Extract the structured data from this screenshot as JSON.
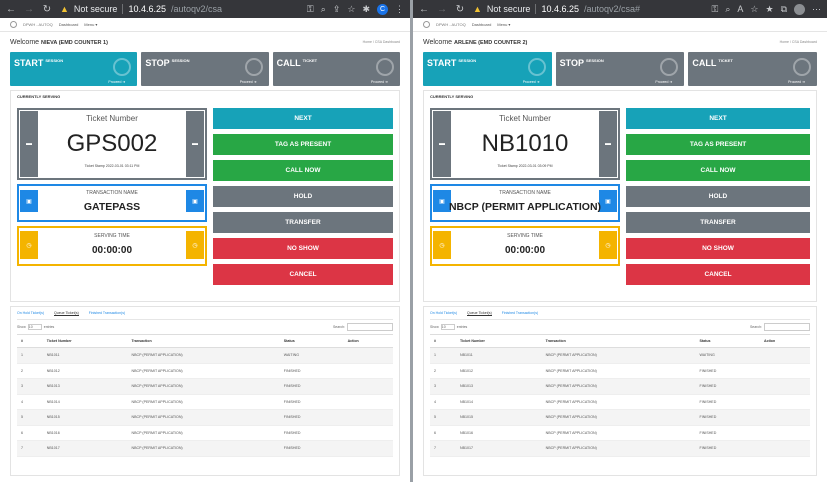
{
  "browser": {
    "security": "Not secure",
    "host": "10.4.6.25",
    "left_path": "/autoqv2/csa",
    "right_path": "/autoqv2/csa#"
  },
  "app": {
    "brand": "DPWH - AUTOQ",
    "menu_dashboard": "Dashboard",
    "menu_more": "Menu ▾",
    "crumbs": "Home / CSA Dashboard"
  },
  "cards": {
    "start": "START",
    "start_sub": "SESSION",
    "stop": "STOP",
    "stop_sub": "SESSION",
    "call": "CALL",
    "call_sub": "TICKET",
    "proceed": "Proceed ➔"
  },
  "labels": {
    "currently_serving": "CURRENTLY SERVING",
    "ticket_number": "Ticket Number",
    "transaction_name": "TRANSACTION NAME",
    "serving_time": "SERVING TIME",
    "ticket_stamp_prefix": "Ticket Stamp"
  },
  "buttons": {
    "next": "NEXT",
    "tag": "TAG AS PRESENT",
    "callnow": "CALL NOW",
    "hold": "HOLD",
    "transfer": "TRANSFER",
    "noshow": "NO SHOW",
    "cancel": "CANCEL"
  },
  "tabs": {
    "onhold": "On Hold Ticket(s)",
    "queue": "Queue Ticket(s)",
    "finished": "Finished Transaction(s)"
  },
  "table": {
    "show": "Show",
    "len": "10",
    "entries": "entries",
    "search": "Search:",
    "headers": [
      "#",
      "Ticket Number",
      "Transaction",
      "Status",
      "Action"
    ]
  },
  "left": {
    "welcome": "Welcome",
    "name": "NIEVA (EMD COUNTER 1)",
    "ticket": "GPS002",
    "stamp": "Ticket Stamp 2022-03-01 03:11 PM",
    "transaction": "GATEPASS",
    "serving_time": "00:00:00",
    "rows": [
      [
        "1",
        "NB1011",
        "NBCP (PERMIT APPLICATION)",
        "WAITING"
      ],
      [
        "2",
        "NB1012",
        "NBCP (PERMIT APPLICATION)",
        "FINISHED"
      ],
      [
        "3",
        "NB1013",
        "NBCP (PERMIT APPLICATION)",
        "FINISHED"
      ],
      [
        "4",
        "NB1014",
        "NBCP (PERMIT APPLICATION)",
        "FINISHED"
      ],
      [
        "5",
        "NB1015",
        "NBCP (PERMIT APPLICATION)",
        "FINISHED"
      ],
      [
        "6",
        "NB1016",
        "NBCP (PERMIT APPLICATION)",
        "FINISHED"
      ],
      [
        "7",
        "NB1017",
        "NBCP (PERMIT APPLICATION)",
        "FINISHED"
      ]
    ]
  },
  "right": {
    "welcome": "Welcome",
    "name": "ARLENE (EMD COUNTER 2)",
    "ticket": "NB1010",
    "stamp": "Ticket Stamp 2022-03-01 03:09 PM",
    "transaction": "NBCP (PERMIT APPLICATION)",
    "serving_time": "00:00:00",
    "rows": [
      [
        "1",
        "NB1011",
        "NBCP (PERMIT APPLICATION)",
        "WAITING"
      ],
      [
        "2",
        "NB1012",
        "NBCP (PERMIT APPLICATION)",
        "FINISHED"
      ],
      [
        "3",
        "NB1013",
        "NBCP (PERMIT APPLICATION)",
        "FINISHED"
      ],
      [
        "4",
        "NB1014",
        "NBCP (PERMIT APPLICATION)",
        "FINISHED"
      ],
      [
        "5",
        "NB1015",
        "NBCP (PERMIT APPLICATION)",
        "FINISHED"
      ],
      [
        "6",
        "NB1016",
        "NBCP (PERMIT APPLICATION)",
        "FINISHED"
      ],
      [
        "7",
        "NB1017",
        "NBCP (PERMIT APPLICATION)",
        "FINISHED"
      ]
    ]
  }
}
